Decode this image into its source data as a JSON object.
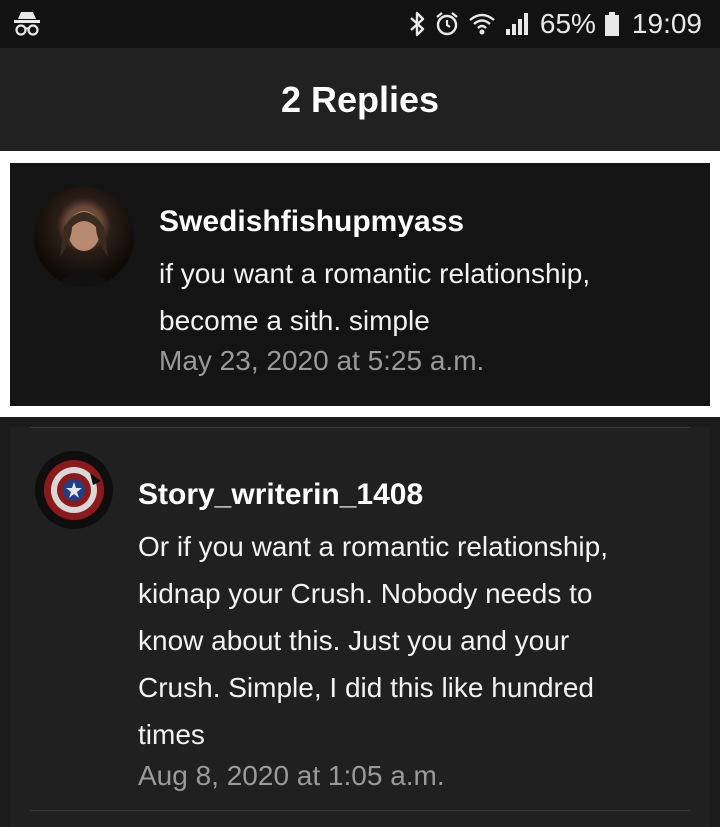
{
  "status_bar": {
    "battery_percent": "65%",
    "time": "19:09",
    "icons": [
      "incognito-icon",
      "bluetooth-icon",
      "alarm-icon",
      "wifi-icon",
      "signal-icon",
      "battery-icon"
    ]
  },
  "header": {
    "title": "2 Replies"
  },
  "comments": [
    {
      "author": "Swedishfishupmyass",
      "body_lines": [
        "if you want a romantic relationship,",
        "become a sith. simple"
      ],
      "timestamp": "May 23, 2020 at 5:25 a.m."
    },
    {
      "author": "Story_writerin_1408",
      "body_lines": [
        "Or if you want a romantic relationship,",
        "kidnap your Crush. Nobody needs to",
        "know about this. Just you and your",
        "Crush. Simple, I did this like hundred",
        "times"
      ],
      "timestamp": "Aug 8, 2020 at 1:05 a.m."
    }
  ],
  "colors": {
    "background": "#1c1c1c",
    "card_main": "#141414",
    "card_reply": "#202020",
    "timestamp": "#9a9a9a"
  }
}
